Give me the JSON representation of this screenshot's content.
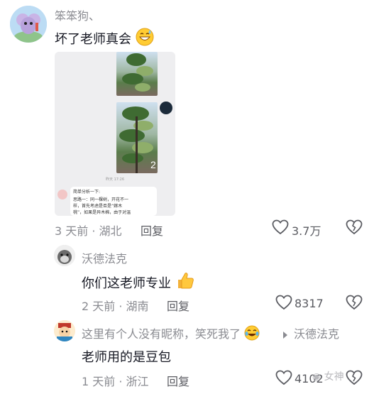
{
  "comments": [
    {
      "username": "笨笨狗、",
      "text": "坏了老师真会",
      "emoji_icon": "grinning-sweat-emoji-icon",
      "meta": "3 天前 · 湖北",
      "reply_label": "回复",
      "like_count": "3.7万",
      "attachment": {
        "timestamp": "昨天 17:26",
        "badge_number": "2",
        "bubble_title": "简单分析一下:",
        "bubble_lines": [
          "思路一：同一棵树，开花不一",
          "样，首先考虑是否是“嫁木",
          "桃”，如果是异木棉，由于对温"
        ]
      }
    },
    {
      "username": "沃德法克",
      "text": "你们这老师专业",
      "emoji_icon": "thumbs-up-emoji-icon",
      "meta": "2 天前 · 湖南",
      "reply_label": "回复",
      "like_count": "8317"
    },
    {
      "username": "这里有个人没有昵称，笑死我了",
      "emoji_icon": "tears-of-joy-emoji-icon",
      "reply_to": "沃德法克",
      "text": "老师用的是豆包",
      "meta": "1 天前 · 浙江",
      "reply_label": "回复",
      "like_count": "4102",
      "watermark": "女神"
    }
  ],
  "colors": {
    "text": "#161823",
    "secondary": "#8a8b91",
    "background": "#ffffff"
  }
}
